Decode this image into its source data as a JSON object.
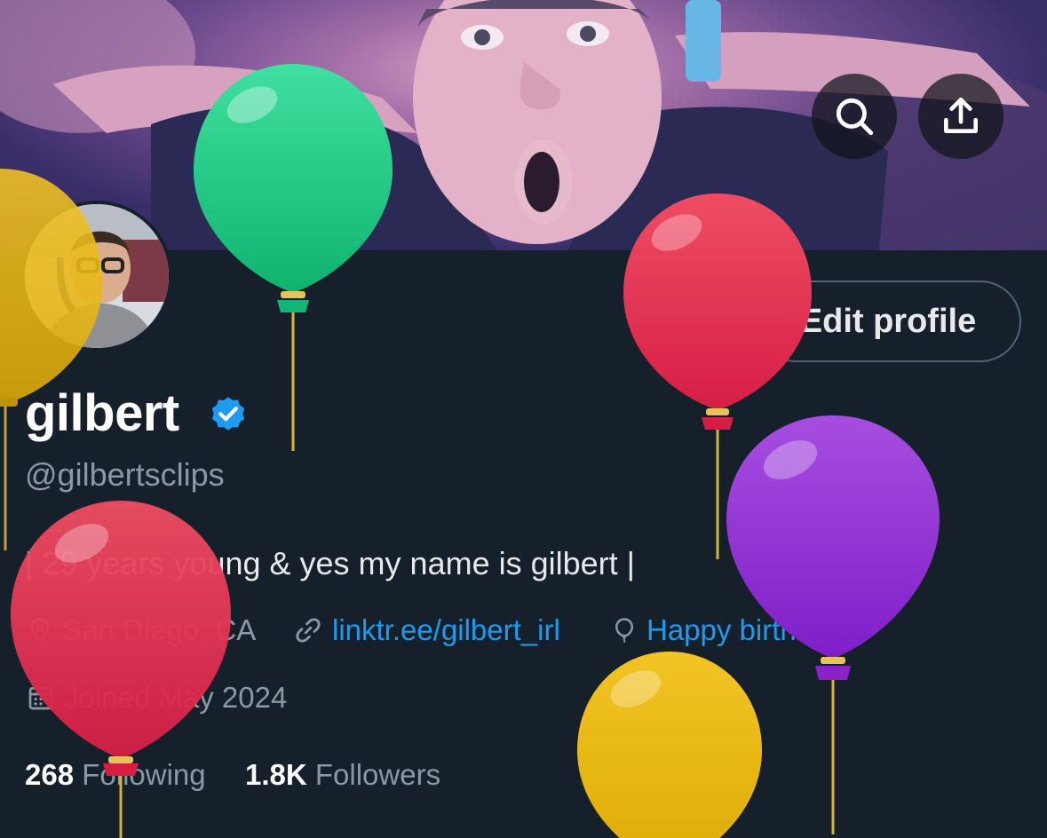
{
  "header": {
    "search_icon": "search-icon",
    "share_icon": "share-icon"
  },
  "profile": {
    "edit_label": "Edit profile",
    "display_name": "gilbert",
    "handle": "@gilbertsclips",
    "bio": "| 29 years young & yes my name is gilbert |",
    "location": "San Diego, CA",
    "link": "linktr.ee/gilbert_irl",
    "birthday": "Happy birthday!",
    "joined": "Joined May 2024",
    "following_count": "268",
    "following_label": "Following",
    "followers_count": "1.8K",
    "followers_label": "Followers"
  },
  "colors": {
    "background": "#15202b",
    "accent": "#1d9bf0",
    "muted": "#8b98a5",
    "balloon_green": "#19c17f",
    "balloon_red": "#e0304f",
    "balloon_purple": "#8e2bd0",
    "balloon_yellow": "#e6b50f"
  }
}
